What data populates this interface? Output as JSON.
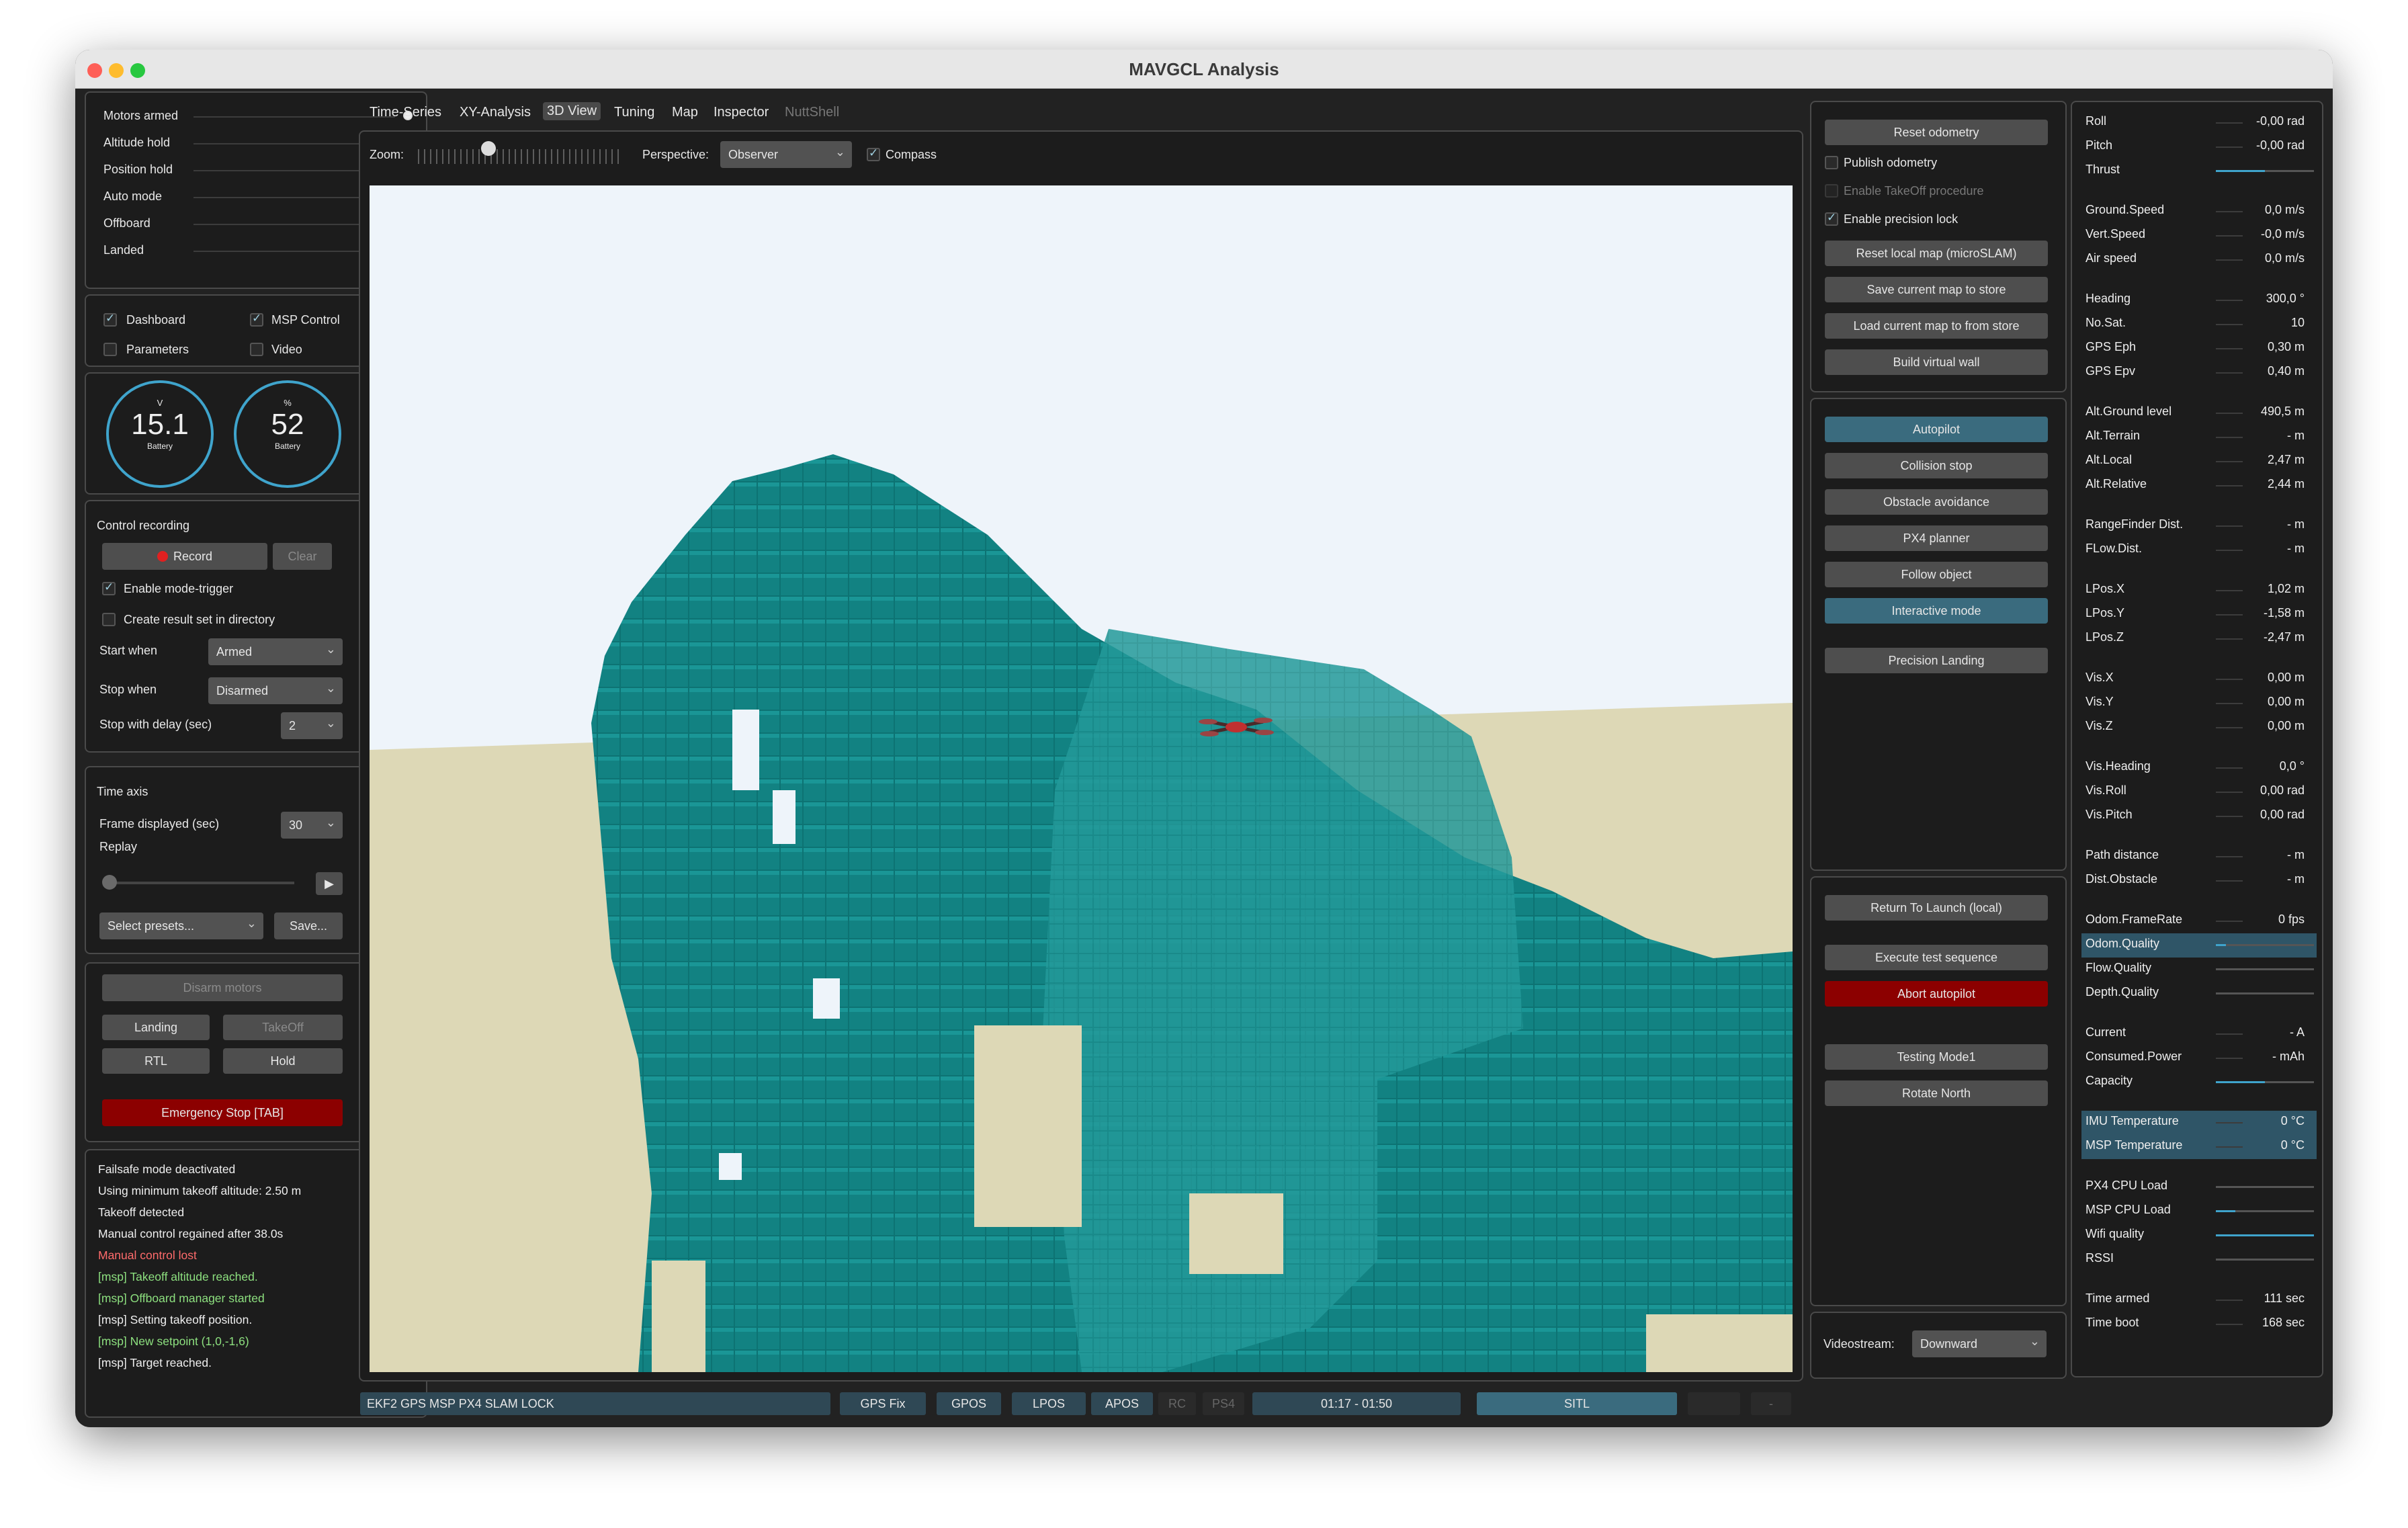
{
  "window": {
    "title": "MAVGCL Analysis"
  },
  "status_leds": [
    {
      "label": "Motors armed",
      "on": true
    },
    {
      "label": "Altitude hold",
      "on": false
    },
    {
      "label": "Position hold",
      "on": false
    },
    {
      "label": "Auto mode",
      "on": false
    },
    {
      "label": "Offboard",
      "on": true
    },
    {
      "label": "Landed",
      "on": false
    }
  ],
  "view_toggles": {
    "dashboard": "Dashboard",
    "msp_control": "MSP Control",
    "parameters": "Parameters",
    "video": "Video"
  },
  "battery": {
    "voltage_unit": "V",
    "voltage": "15.1",
    "voltage_label": "Battery",
    "percent_unit": "%",
    "percent": "52",
    "percent_label": "Battery"
  },
  "recording": {
    "title": "Control recording",
    "record": "Record",
    "clear": "Clear",
    "mode_trigger": "Enable mode-trigger",
    "result_dir": "Create result set in directory",
    "start_when_label": "Start when",
    "start_when": "Armed",
    "stop_when_label": "Stop when",
    "stop_when": "Disarmed",
    "delay_label": "Stop with delay (sec)",
    "delay": "2"
  },
  "time_axis": {
    "title": "Time axis",
    "frame_label": "Frame displayed (sec)",
    "frame": "30",
    "replay": "Replay",
    "presets": "Select presets...",
    "save": "Save..."
  },
  "commands": {
    "disarm": "Disarm motors",
    "landing": "Landing",
    "takeoff": "TakeOff",
    "rtl": "RTL",
    "hold": "Hold",
    "emergency": "Emergency Stop [TAB]"
  },
  "log": [
    {
      "text": "Failsafe mode deactivated",
      "type": "normal"
    },
    {
      "text": "Using minimum takeoff altitude: 2.50 m",
      "type": "normal"
    },
    {
      "text": "Takeoff detected",
      "type": "normal"
    },
    {
      "text": "Manual control regained after 38.0s",
      "type": "normal"
    },
    {
      "text": "Manual control lost",
      "type": "red"
    },
    {
      "text": "[msp] Takeoff altitude reached.",
      "type": "grn"
    },
    {
      "text": "[msp] Offboard manager started",
      "type": "grn"
    },
    {
      "text": "[msp] Setting takeoff position.",
      "type": "normal"
    },
    {
      "text": "[msp] New setpoint (1,0,-1,6)",
      "type": "grn"
    },
    {
      "text": "[msp] Target reached.",
      "type": "normal"
    }
  ],
  "tabs": [
    "Time-Series",
    "XY-Analysis",
    "3D View",
    "Tuning",
    "Map",
    "Inspector",
    "NuttShell"
  ],
  "view3d": {
    "zoom_label": "Zoom:",
    "perspective_label": "Perspective:",
    "perspective": "Observer",
    "compass": "Compass"
  },
  "colors": {
    "voxel": "#0f7a7a",
    "voxel_light": "#1a9090",
    "sky": "#eef5fb",
    "ground": "#ddd8b5"
  },
  "slam_panel": {
    "reset_odometry": "Reset odometry",
    "publish_odometry": "Publish odometry",
    "takeoff_proc": "Enable TakeOff procedure",
    "precision_lock": "Enable precision lock",
    "reset_map": "Reset local map (microSLAM)",
    "save_map": "Save current map to store",
    "load_map": "Load current map to from store",
    "virtual_wall": "Build virtual wall"
  },
  "mode_panel": {
    "autopilot": "Autopilot",
    "collision": "Collision stop",
    "obstacle": "Obstacle avoidance",
    "px4planner": "PX4 planner",
    "follow": "Follow object",
    "interactive": "Interactive mode",
    "precision": "Precision Landing"
  },
  "action_panel": {
    "rtl_local": "Return To Launch (local)",
    "test_seq": "Execute test sequence",
    "abort": "Abort autopilot",
    "testing": "Testing Mode1",
    "rotate": "Rotate North"
  },
  "videostream": {
    "label": "Videostream:",
    "value": "Downward"
  },
  "telemetry": [
    {
      "label": "Roll",
      "value": "-0,00 rad"
    },
    {
      "label": "Pitch",
      "value": "-0,00 rad"
    },
    {
      "label": "Thrust",
      "value": "",
      "bar": 0.5
    },
    {
      "label": "Ground.Speed",
      "value": "0,0 m/s"
    },
    {
      "label": "Vert.Speed",
      "value": "-0,0 m/s"
    },
    {
      "label": "Air speed",
      "value": "0,0 m/s"
    },
    {
      "label": "Heading",
      "value": "300,0 °"
    },
    {
      "label": "No.Sat.",
      "value": "10"
    },
    {
      "label": "GPS Eph",
      "value": "0,30 m"
    },
    {
      "label": "GPS Epv",
      "value": "0,40 m"
    },
    {
      "label": "Alt.Ground level",
      "value": "490,5 m"
    },
    {
      "label": "Alt.Terrain",
      "value": "- m"
    },
    {
      "label": "Alt.Local",
      "value": "2,47 m"
    },
    {
      "label": "Alt.Relative",
      "value": "2,44 m"
    },
    {
      "label": "RangeFinder Dist.",
      "value": "- m"
    },
    {
      "label": "FLow.Dist.",
      "value": "- m"
    },
    {
      "label": "LPos.X",
      "value": "1,02 m"
    },
    {
      "label": "LPos.Y",
      "value": "-1,58 m"
    },
    {
      "label": "LPos.Z",
      "value": "-2,47 m"
    },
    {
      "label": "Vis.X",
      "value": "0,00 m"
    },
    {
      "label": "Vis.Y",
      "value": "0,00 m"
    },
    {
      "label": "Vis.Z",
      "value": "0,00 m"
    },
    {
      "label": "Vis.Heading",
      "value": "0,0 °"
    },
    {
      "label": "Vis.Roll",
      "value": "0,00 rad"
    },
    {
      "label": "Vis.Pitch",
      "value": "0,00 rad"
    },
    {
      "label": "Path distance",
      "value": "- m"
    },
    {
      "label": "Dist.Obstacle",
      "value": "- m"
    },
    {
      "label": "Odom.FrameRate",
      "value": "0 fps"
    },
    {
      "label": "Odom.Quality",
      "value": "",
      "bar": 0.1,
      "highlight": true
    },
    {
      "label": "Flow.Quality",
      "value": "",
      "bar": 0
    },
    {
      "label": "Depth.Quality",
      "value": "",
      "bar": 0
    },
    {
      "label": "Current",
      "value": "- A"
    },
    {
      "label": "Consumed.Power",
      "value": "- mAh"
    },
    {
      "label": "Capacity",
      "value": "",
      "bar": 0.5
    },
    {
      "label": "IMU Temperature",
      "value": "0 °C",
      "highlight": true
    },
    {
      "label": "MSP Temperature",
      "value": "0 °C",
      "highlight": true
    },
    {
      "label": "PX4 CPU Load",
      "value": "",
      "bar": 0
    },
    {
      "label": "MSP CPU Load",
      "value": "",
      "bar": 0.2
    },
    {
      "label": "Wifi quality",
      "value": "",
      "bar": 1.0
    },
    {
      "label": "RSSI",
      "value": "",
      "bar": 0
    },
    {
      "label": "Time armed",
      "value": "111 sec"
    },
    {
      "label": "Time boot",
      "value": "168 sec"
    }
  ],
  "statusbar": {
    "sensors": "EKF2 GPS MSP PX4 SLAM LOCK",
    "gpsfix": "GPS Fix",
    "gpos": "GPOS",
    "lpos": "LPOS",
    "apos": "APOS",
    "rc": "RC",
    "ps4": "PS4",
    "time": "01:17 - 01:50",
    "sitl": "SITL",
    "dash": "-"
  }
}
